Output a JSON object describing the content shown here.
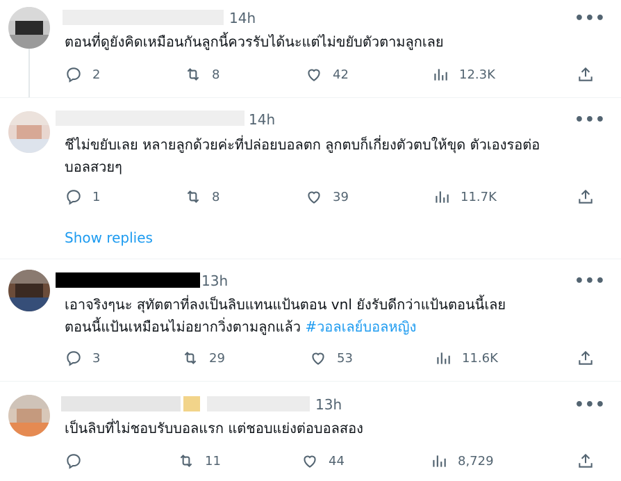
{
  "tweets": [
    {
      "time": "14h",
      "text": "ตอนที่ดูยังคิดเหมือนกันลูกนี้ควรรับได้นะแต่ไม่ขยับตัวตามลูกเลย",
      "text2": "",
      "hashtag": "",
      "replies": "2",
      "retweets": "8",
      "likes": "42",
      "views": "12.3K"
    },
    {
      "time": "14h",
      "text": "ชีไม่ขยับเลย หลายลูกด้วยค่ะที่ปล่อยบอลตก ลูกตบก็เกี่ยงตัวตบให้ขุด ตัวเองรอต่อ",
      "text2": "บอลสวยๆ",
      "hashtag": "",
      "replies": "1",
      "retweets": "8",
      "likes": "39",
      "views": "11.7K"
    },
    {
      "time": "13h",
      "text": "เอาจริงๆนะ สุทัตตาที่ลงเป็นลิบแทนแป้นตอน vnl ยังรับดีกว่าแป้นตอนนี้เลย",
      "text2": "ตอนนี้แป้นเหมือนไม่อยากวิ่งตามลูกแล้ว ",
      "hashtag": "#วอลเลย์บอลหญิง",
      "replies": "3",
      "retweets": "29",
      "likes": "53",
      "views": "11.6K"
    },
    {
      "time": "13h",
      "text": "เป็นลิบที่ไม่ชอบรับบอลแรก แต่ชอบแย่งต่อบอลสอง",
      "text2": "",
      "hashtag": "",
      "replies": "",
      "retweets": "11",
      "likes": "44",
      "views": "8,729"
    }
  ],
  "show_replies": "Show replies",
  "more_glyph": "•••",
  "colors": {
    "accent": "#1d9bf0",
    "muted": "#536471",
    "text": "#0f1419"
  },
  "icons": [
    "reply-icon",
    "retweet-icon",
    "like-icon",
    "views-icon",
    "share-icon",
    "more-icon"
  ]
}
